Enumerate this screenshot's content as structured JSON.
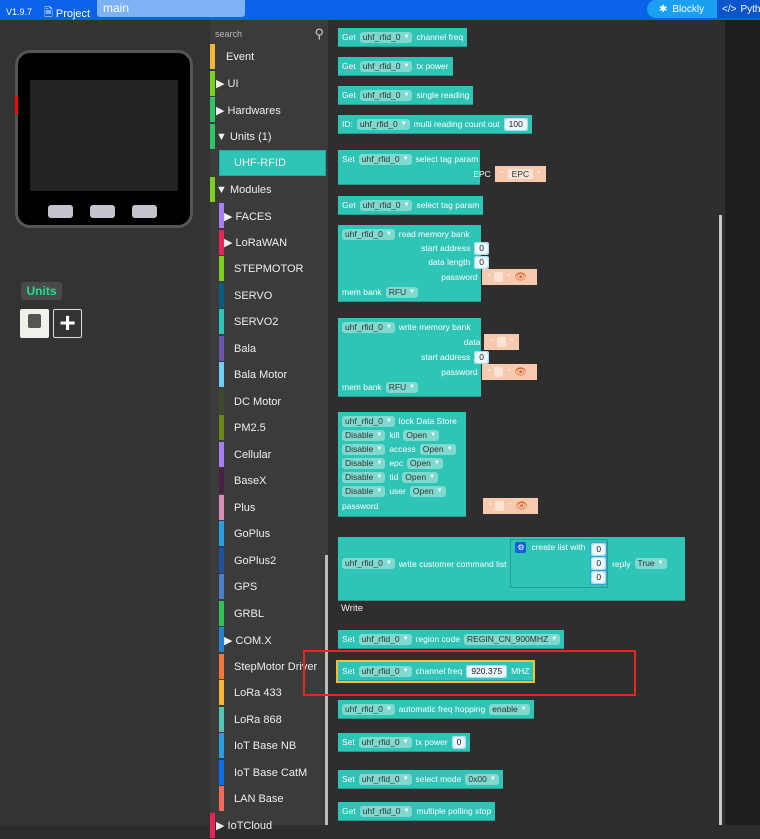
{
  "topbar": {
    "version": "V1.9.7",
    "project": "Project",
    "tab": "main",
    "blockly": "Blockly",
    "python": "Pyth"
  },
  "device": {
    "units_label": "Units"
  },
  "sidebar": {
    "search_placeholder": "search",
    "categories": [
      {
        "label": "Event",
        "color": "#f5b731",
        "arrow": ""
      },
      {
        "label": "UI",
        "color": "#7ccf1c",
        "arrow": "▶"
      },
      {
        "label": "Hardwares",
        "color": "#2ec46a",
        "arrow": "▶"
      },
      {
        "label": "Units (1)",
        "color": "#2ec46a",
        "arrow": "▼"
      },
      {
        "label": "UHF-RFID",
        "color": "#2ec4b6",
        "arrow": "",
        "selected": true
      },
      {
        "label": "Modules",
        "color": "#7ccf1c",
        "arrow": "▼"
      },
      {
        "label": "FACES",
        "color": "#a77ff0",
        "arrow": "▶",
        "sub": true
      },
      {
        "label": "LoRaWAN",
        "color": "#e8245a",
        "arrow": "▶",
        "sub": true
      },
      {
        "label": "STEPMOTOR",
        "color": "#7ccf1c",
        "arrow": "",
        "sub": true
      },
      {
        "label": "SERVO",
        "color": "#0b5a80",
        "arrow": "",
        "sub": true
      },
      {
        "label": "SERVO2",
        "color": "#2ec4b6",
        "arrow": "",
        "sub": true
      },
      {
        "label": "Bala",
        "color": "#6a55a8",
        "arrow": "",
        "sub": true
      },
      {
        "label": "Bala Motor",
        "color": "#6fcff5",
        "arrow": "",
        "sub": true
      },
      {
        "label": "DC Motor",
        "color": "#3b4a30",
        "arrow": "",
        "sub": true
      },
      {
        "label": "PM2.5",
        "color": "#6b8a1e",
        "arrow": "",
        "sub": true
      },
      {
        "label": "Cellular",
        "color": "#a77ff0",
        "arrow": "",
        "sub": true
      },
      {
        "label": "BaseX",
        "color": "#4a2040",
        "arrow": "",
        "sub": true
      },
      {
        "label": "Plus",
        "color": "#d98fb5",
        "arrow": "",
        "sub": true
      },
      {
        "label": "GoPlus",
        "color": "#2a9ee0",
        "arrow": "",
        "sub": true
      },
      {
        "label": "GoPlus2",
        "color": "#2050a0",
        "arrow": "",
        "sub": true
      },
      {
        "label": "GPS",
        "color": "#4a80c8",
        "arrow": "",
        "sub": true
      },
      {
        "label": "GRBL",
        "color": "#2ec45a",
        "arrow": "",
        "sub": true
      },
      {
        "label": "COM.X",
        "color": "#2a80d0",
        "arrow": "▶",
        "sub": true
      },
      {
        "label": "StepMotor Driver",
        "color": "#ef7a3a",
        "arrow": "",
        "sub": true
      },
      {
        "label": "LoRa 433",
        "color": "#f5b731",
        "arrow": "",
        "sub": true
      },
      {
        "label": "LoRa 868",
        "color": "#4ec8b0",
        "arrow": "",
        "sub": true
      },
      {
        "label": "IoT Base NB",
        "color": "#2a9ee0",
        "arrow": "",
        "sub": true
      },
      {
        "label": "IoT Base CatM",
        "color": "#0a70f0",
        "arrow": "",
        "sub": true
      },
      {
        "label": "LAN Base",
        "color": "#f06a5a",
        "arrow": "",
        "sub": true
      },
      {
        "label": "IoTCloud",
        "color": "#e8245a",
        "arrow": "▶"
      }
    ]
  },
  "workspace": {
    "write_label": "Write",
    "blocks": [
      {
        "name": "get-channel-freq-block",
        "rows": [
          [
            {
              "t": "Get"
            },
            {
              "dd": "uhf_rfid_0"
            },
            {
              "t": "channel freq"
            }
          ]
        ]
      },
      {
        "name": "get-tx-power-block",
        "rows": [
          [
            {
              "t": "Get"
            },
            {
              "dd": "uhf_rfid_0"
            },
            {
              "t": "tx power"
            }
          ]
        ]
      },
      {
        "name": "get-single-reading-block",
        "rows": [
          [
            {
              "t": "Get"
            },
            {
              "dd": "uhf_rfid_0"
            },
            {
              "t": "single reading"
            }
          ]
        ]
      },
      {
        "name": "multi-reading-block",
        "rows": [
          [
            {
              "t": "ID:"
            },
            {
              "dd": "uhf_rfid_0"
            },
            {
              "t": "multi reading count out"
            },
            {
              "num": "100"
            }
          ]
        ]
      },
      {
        "name": "set-select-tag-param-block",
        "rows": [
          [
            {
              "t": "Set"
            },
            {
              "dd": "uhf_rfid_0"
            },
            {
              "t": "select tag param"
            }
          ],
          [
            {
              "t": "EPC"
            },
            {
              "str": "EPC"
            }
          ]
        ]
      },
      {
        "name": "get-select-tag-param-block",
        "rows": [
          [
            {
              "t": "Get"
            },
            {
              "dd": "uhf_rfid_0"
            },
            {
              "t": "select tag param"
            }
          ]
        ]
      },
      {
        "name": "read-memory-bank-block",
        "rows": [
          [
            {
              "dd": "uhf_rfid_0"
            },
            {
              "t": "read memory bank"
            }
          ],
          [
            {
              "t": "start address"
            },
            {
              "num": "0"
            }
          ],
          [
            {
              "t": "data length"
            },
            {
              "num": "0"
            }
          ],
          [
            {
              "t": "password"
            },
            {
              "pw": ""
            }
          ],
          [
            {
              "t": "mem bank"
            },
            {
              "dd": "RFU"
            }
          ]
        ]
      },
      {
        "name": "write-memory-bank-block",
        "rows": [
          [
            {
              "dd": "uhf_rfid_0"
            },
            {
              "t": "write memory bank"
            }
          ],
          [
            {
              "t": "data"
            },
            {
              "str": ""
            }
          ],
          [
            {
              "t": "start address"
            },
            {
              "num": "0"
            }
          ],
          [
            {
              "t": "password"
            },
            {
              "pw": ""
            }
          ],
          [
            {
              "t": "mem bank"
            },
            {
              "dd": "RFU"
            }
          ]
        ]
      },
      {
        "name": "lock-data-store-block",
        "rows": [
          [
            {
              "dd": "uhf_rfid_0"
            },
            {
              "t": "lock Data Store"
            }
          ],
          [
            {
              "dd": "Disable"
            },
            {
              "t": "kill"
            },
            {
              "dd": "Open"
            }
          ],
          [
            {
              "dd": "Disable"
            },
            {
              "t": "access"
            },
            {
              "dd": "Open"
            }
          ],
          [
            {
              "dd": "Disable"
            },
            {
              "t": "epc"
            },
            {
              "dd": "Open"
            }
          ],
          [
            {
              "dd": "Disable"
            },
            {
              "t": "tid"
            },
            {
              "dd": "Open"
            }
          ],
          [
            {
              "dd": "Disable"
            },
            {
              "t": "user"
            },
            {
              "dd": "Open"
            }
          ],
          [
            {
              "t": "password"
            },
            {
              "pw": ""
            }
          ]
        ]
      },
      {
        "name": "write-customer-command-block",
        "rows": [
          [
            {
              "dd": "uhf_rfid_0"
            },
            {
              "t": "write customer command list"
            },
            {
              "list": {
                "label": "create list with",
                "items": [
                  "0",
                  "0",
                  "0"
                ]
              }
            },
            {
              "t": "reply"
            },
            {
              "dd": "True"
            }
          ]
        ]
      },
      {
        "name": "set-region-code-block",
        "rows": [
          [
            {
              "t": "Set"
            },
            {
              "dd": "uhf_rfid_0"
            },
            {
              "t": "region code"
            },
            {
              "dd": "REGIN_CN_900MHZ"
            }
          ]
        ]
      },
      {
        "name": "set-channel-freq-block",
        "rows": [
          [
            {
              "t": "Set"
            },
            {
              "dd": "uhf_rfid_0"
            },
            {
              "t": "channel freq"
            },
            {
              "num": "920.375"
            },
            {
              "t": "MHZ"
            }
          ]
        ],
        "selected": true
      },
      {
        "name": "auto-freq-hopping-block",
        "rows": [
          [
            {
              "dd": "uhf_rfid_0"
            },
            {
              "t": "automatic freq hopping"
            },
            {
              "dd": "enable"
            }
          ]
        ]
      },
      {
        "name": "set-tx-power-block",
        "rows": [
          [
            {
              "t": "Set"
            },
            {
              "dd": "uhf_rfid_0"
            },
            {
              "t": "tx power"
            },
            {
              "num": "0"
            }
          ]
        ]
      },
      {
        "name": "set-select-mode-block",
        "rows": [
          [
            {
              "t": "Set"
            },
            {
              "dd": "uhf_rfid_0"
            },
            {
              "t": "select mode"
            },
            {
              "dd": "0x00"
            }
          ]
        ]
      },
      {
        "name": "get-multiple-polling-stop-block",
        "rows": [
          [
            {
              "t": "Get"
            },
            {
              "dd": "uhf_rfid_0"
            },
            {
              "t": "multiple polling stop"
            }
          ]
        ]
      }
    ]
  }
}
